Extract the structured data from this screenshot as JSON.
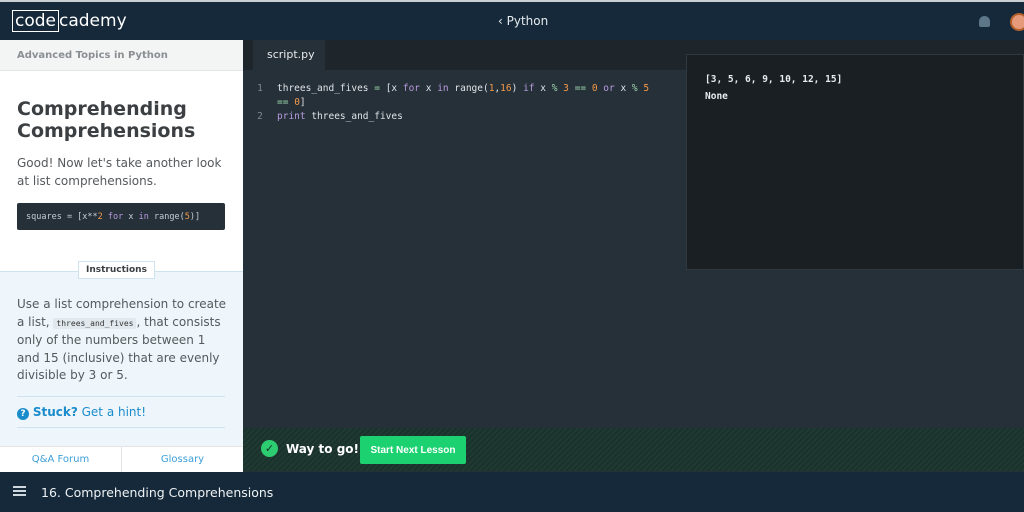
{
  "header": {
    "logo_box": "code",
    "logo_rest": "cademy",
    "course": "Python",
    "back_icon": "chevron-left-icon"
  },
  "lesson": {
    "breadcrumb": "Advanced Topics in Python",
    "title": "Comprehending Comprehensions",
    "intro": "Good! Now let's take another look at list comprehensions.",
    "snippet": [
      "squares = [x**",
      "2",
      " for",
      " x",
      " in",
      " range(",
      "5",
      ")]"
    ],
    "instructions_tab": "Instructions",
    "instr_before": "Use a list comprehension to create a list, ",
    "instr_code": "threes_and_fives",
    "instr_after": ", that consists only of the numbers between 1 and 15 (inclusive) that are evenly divisible by 3 or 5.",
    "stuck": "Stuck?",
    "hint": " Get a hint!",
    "qa": "Q&A Forum",
    "glossary": "Glossary"
  },
  "editor": {
    "tab": "script.py",
    "lines": [
      "1",
      "2"
    ]
  },
  "output": {
    "lines": [
      "[3, 5, 6, 9, 10, 12, 15]",
      "None"
    ]
  },
  "banner": {
    "message": "Way to go!",
    "button": "Start Next Lesson",
    "accent": "#1cd16f"
  },
  "footer": {
    "lesson_title": "16. Comprehending Comprehensions"
  }
}
